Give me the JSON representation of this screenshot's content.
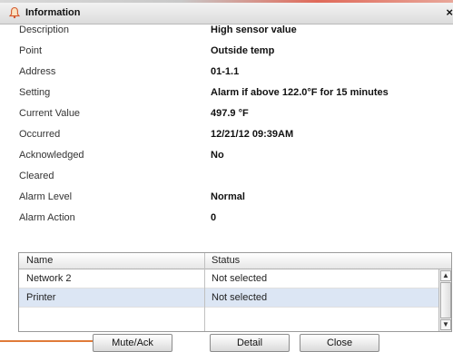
{
  "window": {
    "title": "Information",
    "close_symbol": "×",
    "icons": {
      "title_icon": "alarm-bell-icon"
    }
  },
  "details": [
    {
      "label": "Description",
      "value": "High sensor value"
    },
    {
      "label": "Point",
      "value": "Outside temp"
    },
    {
      "label": "Address",
      "value": "01-1.1"
    },
    {
      "label": "Setting",
      "value": "Alarm if above 122.0°F for 15 minutes"
    },
    {
      "label": "Current Value",
      "value": "497.9 °F"
    },
    {
      "label": "Occurred",
      "value": "12/21/12 09:39AM"
    },
    {
      "label": "Acknowledged",
      "value": "No"
    },
    {
      "label": "Cleared",
      "value": ""
    },
    {
      "label": "Alarm Level",
      "value": "Normal"
    },
    {
      "label": "Alarm Action",
      "value": "0"
    }
  ],
  "table": {
    "columns": [
      "Name",
      "Status"
    ],
    "rows": [
      {
        "name": "Network 2",
        "status": "Not selected",
        "selected": false
      },
      {
        "name": "Printer",
        "status": "Not selected",
        "selected": true
      }
    ]
  },
  "buttons": {
    "mute_ack": "Mute/Ack",
    "detail": "Detail",
    "close": "Close"
  },
  "colors": {
    "accent_callout": "#e07b39",
    "selected_row": "#dce6f4"
  }
}
